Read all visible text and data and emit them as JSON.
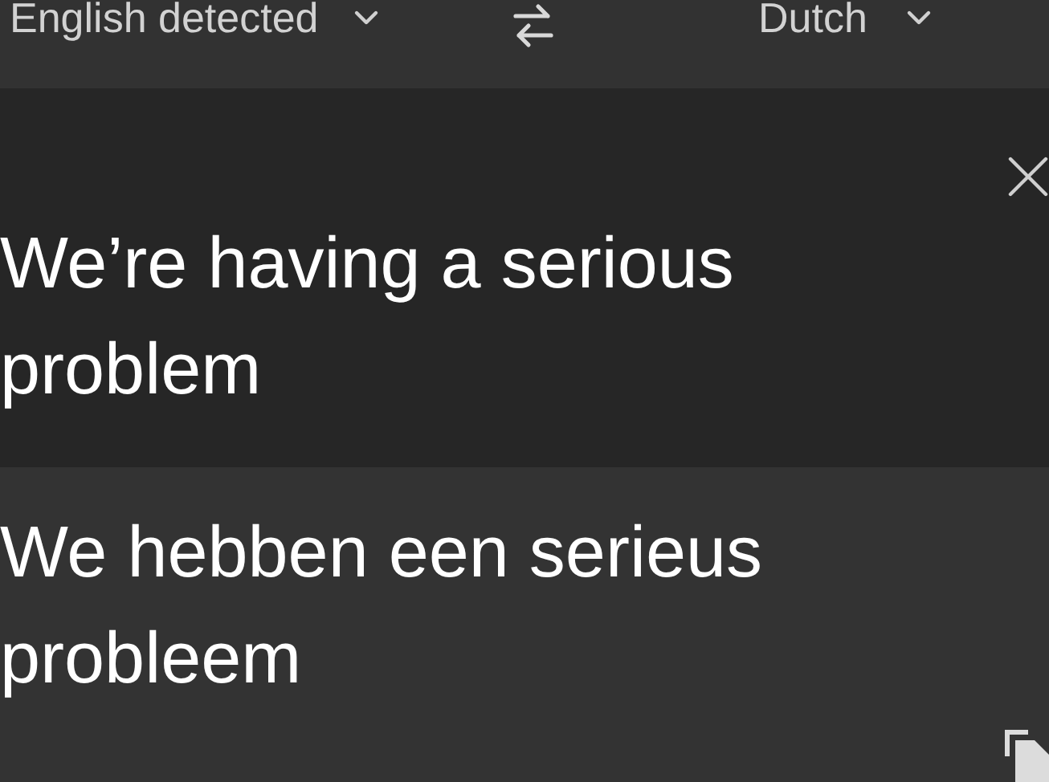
{
  "source_language": {
    "label": "English detected"
  },
  "target_language": {
    "label": "Dutch"
  },
  "source_text": "We’re having a serious problem",
  "translation": "We hebben een serieus probleem"
}
